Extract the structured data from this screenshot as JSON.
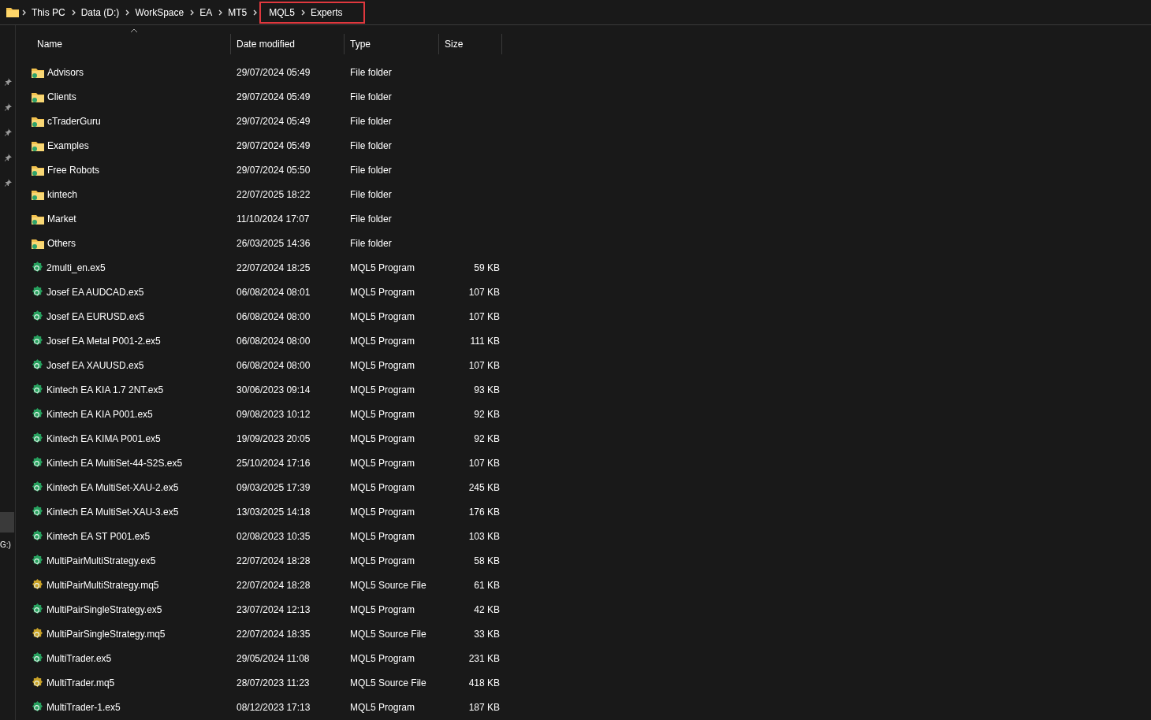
{
  "breadcrumb": [
    {
      "label": "This PC"
    },
    {
      "label": "Data (D:)"
    },
    {
      "label": "WorkSpace"
    },
    {
      "label": "EA"
    },
    {
      "label": "MT5"
    },
    {
      "label": "MQL5",
      "highlighted": true
    },
    {
      "label": "Experts",
      "highlighted": true
    }
  ],
  "sidebar": {
    "items": [
      {
        "pinned": true
      },
      {
        "pinned": true
      },
      {
        "pinned": true
      },
      {
        "pinned": true
      },
      {
        "pinned": true
      }
    ],
    "drives": [
      {
        "selected": true
      },
      {
        "label": "G:)",
        "selected": false
      }
    ]
  },
  "table": {
    "columns": [
      "Name",
      "Date modified",
      "Type",
      "Size"
    ],
    "rows": [
      {
        "kind": "folder",
        "name": "Advisors",
        "date": "29/07/2024 05:49",
        "type": "File folder"
      },
      {
        "kind": "folder",
        "name": "Clients",
        "date": "29/07/2024 05:49",
        "type": "File folder"
      },
      {
        "kind": "folder",
        "name": "cTraderGuru",
        "date": "29/07/2024 05:49",
        "type": "File folder"
      },
      {
        "kind": "folder",
        "name": "Examples",
        "date": "29/07/2024 05:49",
        "type": "File folder"
      },
      {
        "kind": "folder",
        "name": "Free Robots",
        "date": "29/07/2024 05:50",
        "type": "File folder"
      },
      {
        "kind": "folder",
        "name": "kintech",
        "date": "22/07/2025 18:22",
        "type": "File folder"
      },
      {
        "kind": "folder",
        "name": "Market",
        "date": "11/10/2024 17:07",
        "type": "File folder"
      },
      {
        "kind": "folder",
        "name": "Others",
        "date": "26/03/2025 14:36",
        "type": "File folder"
      },
      {
        "kind": "program",
        "name": "2multi_en.ex5",
        "date": "22/07/2024 18:25",
        "type": "MQL5 Program",
        "size": "59 KB"
      },
      {
        "kind": "program",
        "name": "Josef EA AUDCAD.ex5",
        "date": "06/08/2024 08:01",
        "type": "MQL5 Program",
        "size": "107 KB"
      },
      {
        "kind": "program",
        "name": "Josef EA EURUSD.ex5",
        "date": "06/08/2024 08:00",
        "type": "MQL5 Program",
        "size": "107 KB"
      },
      {
        "kind": "program",
        "name": "Josef EA Metal P001-2.ex5",
        "date": "06/08/2024 08:00",
        "type": "MQL5 Program",
        "size": "111 KB"
      },
      {
        "kind": "program",
        "name": "Josef EA XAUUSD.ex5",
        "date": "06/08/2024 08:00",
        "type": "MQL5 Program",
        "size": "107 KB"
      },
      {
        "kind": "program",
        "name": "Kintech EA KIA 1.7 2NT.ex5",
        "date": "30/06/2023 09:14",
        "type": "MQL5 Program",
        "size": "93 KB"
      },
      {
        "kind": "program",
        "name": "Kintech EA KIA P001.ex5",
        "date": "09/08/2023 10:12",
        "type": "MQL5 Program",
        "size": "92 KB"
      },
      {
        "kind": "program",
        "name": "Kintech EA KIMA P001.ex5",
        "date": "19/09/2023 20:05",
        "type": "MQL5 Program",
        "size": "92 KB"
      },
      {
        "kind": "program",
        "name": "Kintech EA MultiSet-44-S2S.ex5",
        "date": "25/10/2024 17:16",
        "type": "MQL5 Program",
        "size": "107 KB"
      },
      {
        "kind": "program",
        "name": "Kintech EA MultiSet-XAU-2.ex5",
        "date": "09/03/2025 17:39",
        "type": "MQL5 Program",
        "size": "245 KB"
      },
      {
        "kind": "program",
        "name": "Kintech EA MultiSet-XAU-3.ex5",
        "date": "13/03/2025 14:18",
        "type": "MQL5 Program",
        "size": "176 KB"
      },
      {
        "kind": "program",
        "name": "Kintech EA ST P001.ex5",
        "date": "02/08/2023 10:35",
        "type": "MQL5 Program",
        "size": "103 KB"
      },
      {
        "kind": "program",
        "name": "MultiPairMultiStrategy.ex5",
        "date": "22/07/2024 18:28",
        "type": "MQL5 Program",
        "size": "58 KB"
      },
      {
        "kind": "source",
        "name": "MultiPairMultiStrategy.mq5",
        "date": "22/07/2024 18:28",
        "type": "MQL5 Source File",
        "size": "61 KB"
      },
      {
        "kind": "program",
        "name": "MultiPairSingleStrategy.ex5",
        "date": "23/07/2024 12:13",
        "type": "MQL5 Program",
        "size": "42 KB"
      },
      {
        "kind": "source",
        "name": "MultiPairSingleStrategy.mq5",
        "date": "22/07/2024 18:35",
        "type": "MQL5 Source File",
        "size": "33 KB"
      },
      {
        "kind": "program",
        "name": "MultiTrader.ex5",
        "date": "29/05/2024 11:08",
        "type": "MQL5 Program",
        "size": "231 KB"
      },
      {
        "kind": "source",
        "name": "MultiTrader.mq5",
        "date": "28/07/2023 11:23",
        "type": "MQL5 Source File",
        "size": "418 KB"
      },
      {
        "kind": "program",
        "name": "MultiTrader-1.ex5",
        "date": "08/12/2023 17:13",
        "type": "MQL5 Program",
        "size": "187 KB"
      }
    ]
  }
}
